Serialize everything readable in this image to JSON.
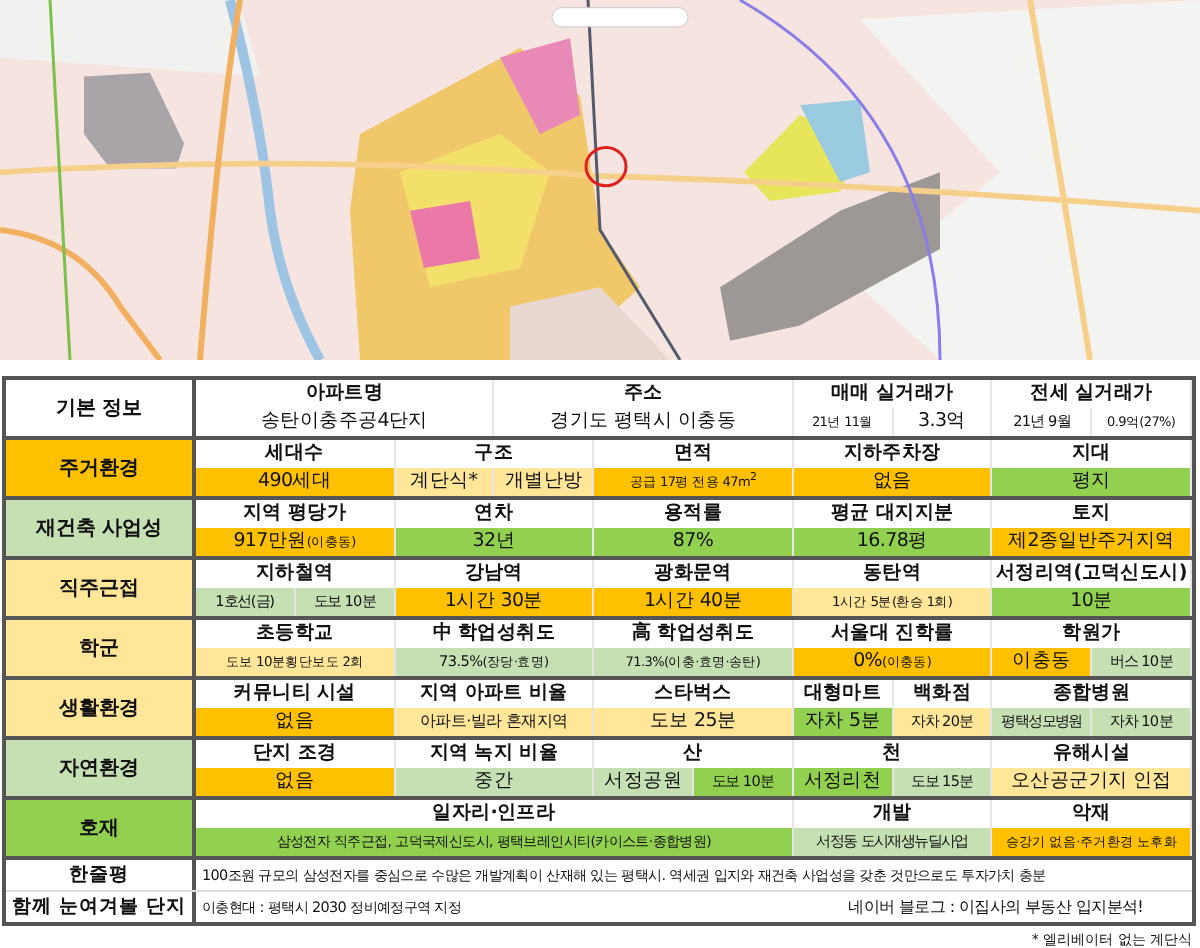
{
  "sections": [
    {
      "label": "기본 정보",
      "color": "#ffffff",
      "headers": [
        "아파트명",
        "주소",
        "매매 실거래가",
        "전세 실거래가"
      ],
      "values": [
        {
          "text": "송탄이충주공4단지",
          "color": "#ffffff"
        },
        {
          "text": "경기도 평택시 이충동",
          "color": "#ffffff"
        },
        {
          "text": "21년 11월",
          "color": "#ffffff"
        },
        {
          "text": "3.3억",
          "color": "#ffffff"
        },
        {
          "text": "21년 9월",
          "color": "#ffffff"
        },
        {
          "text": "0.9억",
          "note": "(27%)",
          "color": "#ffffff"
        }
      ]
    },
    {
      "label": "주거환경",
      "color": "#ffc000",
      "headers": [
        "세대수",
        "구조",
        "면적",
        "지하주차장",
        "지대"
      ],
      "values": [
        {
          "text": "490세대",
          "color": "#ffc000"
        },
        {
          "text": "계단식*",
          "color": "#ffe699"
        },
        {
          "text": "개별난방",
          "color": "#ffe699"
        },
        {
          "text": "공급 17평  전용 47m$^{2}$",
          "color": "#ffc000"
        },
        {
          "text": "없음",
          "color": "#ffc000"
        },
        {
          "text": "평지",
          "color": "#92d050"
        }
      ]
    },
    {
      "label": "재건축 사업성",
      "color": "#c6e0b4",
      "headers": [
        "지역 평당가",
        "연차",
        "용적률",
        "평균 대지지분",
        "토지"
      ],
      "values": [
        {
          "text": "917만원",
          "note": "(이충동)",
          "color": "#ffc000"
        },
        {
          "text": "32년",
          "color": "#92d050"
        },
        {
          "text": "87%",
          "color": "#92d050"
        },
        {
          "text": "16.78평",
          "color": "#92d050"
        },
        {
          "text": "제2종일반주거지역",
          "color": "#ffc000"
        }
      ]
    },
    {
      "label": "직주근접",
      "color": "#ffe699",
      "headers": [
        "지하철역",
        "강남역",
        "광화문역",
        "동탄역",
        "서정리역(고덕신도시)"
      ],
      "values": [
        {
          "text": "1호선(금)",
          "color": "#c6e0b4"
        },
        {
          "text": "도보 10분",
          "color": "#c6e0b4"
        },
        {
          "text": "1시간 30분",
          "color": "#ffc000"
        },
        {
          "text": "1시간 40분",
          "color": "#ffc000"
        },
        {
          "text": "1시간 5분",
          "note": "(환승 1회)",
          "color": "#ffe699"
        },
        {
          "text": "10분",
          "color": "#92d050"
        }
      ]
    },
    {
      "label": "학군",
      "color": "#ffe699",
      "headers": [
        "초등학교",
        "中 학업성취도",
        "高 학업성취도",
        "서울대 진학률",
        "학원가"
      ],
      "values": [
        {
          "text": "도보 10분",
          "note": "횡단보도 2회",
          "color": "#ffe699"
        },
        {
          "text": "73.5%",
          "note": "(장당·효명)",
          "color": "#c6e0b4"
        },
        {
          "text": "71.3%",
          "note": "(이충·효명·송탄)",
          "color": "#c6e0b4"
        },
        {
          "text": "0%",
          "note": "(이충동)",
          "color": "#ffc000"
        },
        {
          "text": "이충동",
          "color": "#ffc000"
        },
        {
          "text": "버스 10분",
          "color": "#c6e0b4"
        }
      ]
    },
    {
      "label": "생활환경",
      "color": "#ffe699",
      "headers": [
        "커뮤니티 시설",
        "지역 아파트 비율",
        "스타벅스",
        "대형마트",
        "백화점",
        "종합병원"
      ],
      "values": [
        {
          "text": "없음",
          "color": "#ffc000"
        },
        {
          "text": "아파트·빌라 혼재지역",
          "color": "#ffe699"
        },
        {
          "text": "도보 25분",
          "color": "#ffe699"
        },
        {
          "text": "자차 5분",
          "color": "#92d050"
        },
        {
          "text": "자차 20분",
          "color": "#ffe699"
        },
        {
          "text": "평택성모병원",
          "color": "#c6e0b4"
        },
        {
          "text": "자차 10분",
          "color": "#c6e0b4"
        }
      ]
    },
    {
      "label": "자연환경",
      "color": "#c6e0b4",
      "headers": [
        "단지 조경",
        "지역 녹지 비율",
        "산",
        "천",
        "유해시설"
      ],
      "values": [
        {
          "text": "없음",
          "color": "#ffc000"
        },
        {
          "text": "중간",
          "color": "#c6e0b4"
        },
        {
          "text": "서정공원",
          "color": "#c6e0b4"
        },
        {
          "text": "도보 10분",
          "color": "#92d050"
        },
        {
          "text": "서정리천",
          "color": "#92d050"
        },
        {
          "text": "도보 15분",
          "color": "#c6e0b4"
        },
        {
          "text": "오산공군기지 인접",
          "color": "#ffe699"
        }
      ]
    },
    {
      "label": "호재",
      "color": "#92d050",
      "headers": [
        "일자리·인프라",
        "개발",
        "악재"
      ],
      "values": [
        {
          "text": "삼성전자 직주근접, 고덕국제신도시, 평택브레인시티(카이스트·종합병원)",
          "color": "#92d050"
        },
        {
          "text": "서정동 도시재생뉴딜사업",
          "color": "#c6e0b4"
        },
        {
          "text": "승강기 없음·주거환경 노후화",
          "color": "#ffc000"
        }
      ]
    }
  ],
  "summary": {
    "label": "한줄평",
    "text": "100조원 규모의 삼성전자를 중심으로 수많은 개발계획이 산재해 있는 평택시. 역세권 입지와 재건축 사업성을 갖춘 것만으로도 투자가치 충분"
  },
  "related": {
    "label": "함께 눈여겨볼 단지",
    "text": "이충현대 : 평택시 2030 정비예정구역 지정",
    "blog": "네이버 블로그 : 이집사의 부동산 입지분석!"
  },
  "footnote": "* 엘리베이터 없는 계단식"
}
